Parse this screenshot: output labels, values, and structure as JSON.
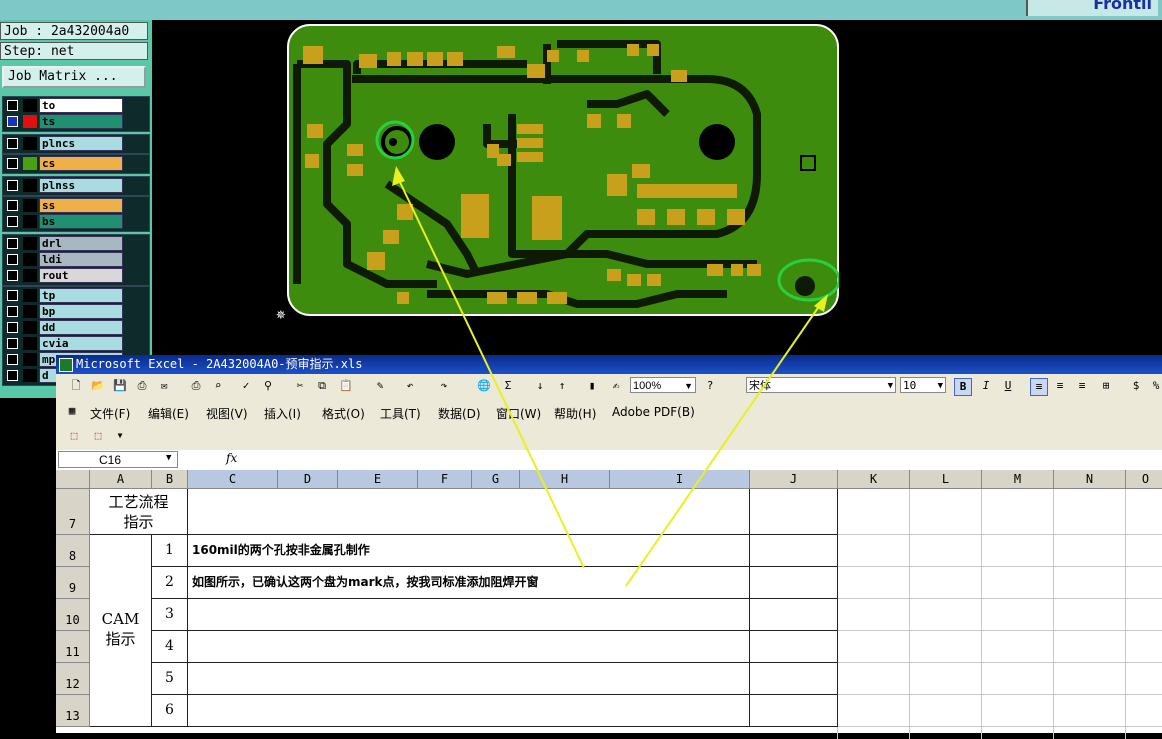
{
  "genesis": {
    "job_line": "Job : 2a432004a0",
    "step_line": "Step: net",
    "job_matrix_button": "Job Matrix ...",
    "logo_text": "Frontli",
    "layers": [
      {
        "name": "to",
        "color": "#ffffff",
        "on": false,
        "swatch": "#000000"
      },
      {
        "name": "ts",
        "color": "#1f9070",
        "on": true,
        "swatch": "#e01010"
      },
      {
        "name": "plncs",
        "color": "#a8dce0",
        "on": false,
        "swatch": "#000000"
      },
      {
        "name": "cs",
        "color": "#f0b048",
        "on": false,
        "swatch": "#49a010"
      },
      {
        "name": "plnss",
        "color": "#a8dce0",
        "on": false,
        "swatch": "#000000"
      },
      {
        "name": "ss",
        "color": "#f0b048",
        "on": false,
        "swatch": "#000000"
      },
      {
        "name": "bs",
        "color": "#1f9070",
        "on": false,
        "swatch": "#000000"
      },
      {
        "name": "drl",
        "color": "#a8b8c0",
        "on": false,
        "swatch": "#000000"
      },
      {
        "name": "ldi",
        "color": "#a8b8c0",
        "on": false,
        "swatch": "#000000"
      },
      {
        "name": "rout",
        "color": "#d8d8d8",
        "on": false,
        "swatch": "#000000"
      },
      {
        "name": "tp",
        "color": "#a8dce0",
        "on": false,
        "swatch": "#000000"
      },
      {
        "name": "bp",
        "color": "#a8dce0",
        "on": false,
        "swatch": "#000000"
      },
      {
        "name": "dd",
        "color": "#a8dce0",
        "on": false,
        "swatch": "#000000"
      },
      {
        "name": "cvia",
        "color": "#a8dce0",
        "on": false,
        "swatch": "#000000"
      },
      {
        "name": "mp",
        "color": "#a8dce0",
        "on": false,
        "swatch": "#000000"
      },
      {
        "name": "d",
        "color": "#a8dce0",
        "on": false,
        "swatch": "#000000"
      }
    ]
  },
  "colors": {
    "board_green": "#3d8c0e",
    "pad_gold": "#c8a01c",
    "mark_circle": "#28d040",
    "arrow": "#e8f020"
  },
  "excel": {
    "title": "Microsoft Excel - 2A432004A0-预审指示.xls",
    "font_name": "宋体",
    "font_size": "10",
    "zoom": "100%",
    "menu": [
      "文件(F)",
      "编辑(E)",
      "视图(V)",
      "插入(I)",
      "格式(O)",
      "工具(T)",
      "数据(D)",
      "窗口(W)",
      "帮助(H)",
      "Adobe PDF(B)"
    ],
    "namebox": "C16",
    "fx": "fx",
    "columns": [
      "A",
      "B",
      "C",
      "D",
      "E",
      "F",
      "G",
      "H",
      "I",
      "J",
      "K",
      "L",
      "M",
      "N",
      "O"
    ],
    "rows": [
      "7",
      "8",
      "9",
      "10",
      "11",
      "12",
      "13"
    ],
    "process_label": "工艺流程\n指示",
    "cam_label": "CAM\n指示",
    "steps": [
      {
        "num": "1",
        "text": "160mil的两个孔按非金属孔制作"
      },
      {
        "num": "2",
        "text": "如图所示，已确认这两个盘为mark点，按我司标准添加阻焊开窗"
      },
      {
        "num": "3",
        "text": ""
      },
      {
        "num": "4",
        "text": ""
      },
      {
        "num": "5",
        "text": ""
      },
      {
        "num": "6",
        "text": ""
      }
    ]
  }
}
